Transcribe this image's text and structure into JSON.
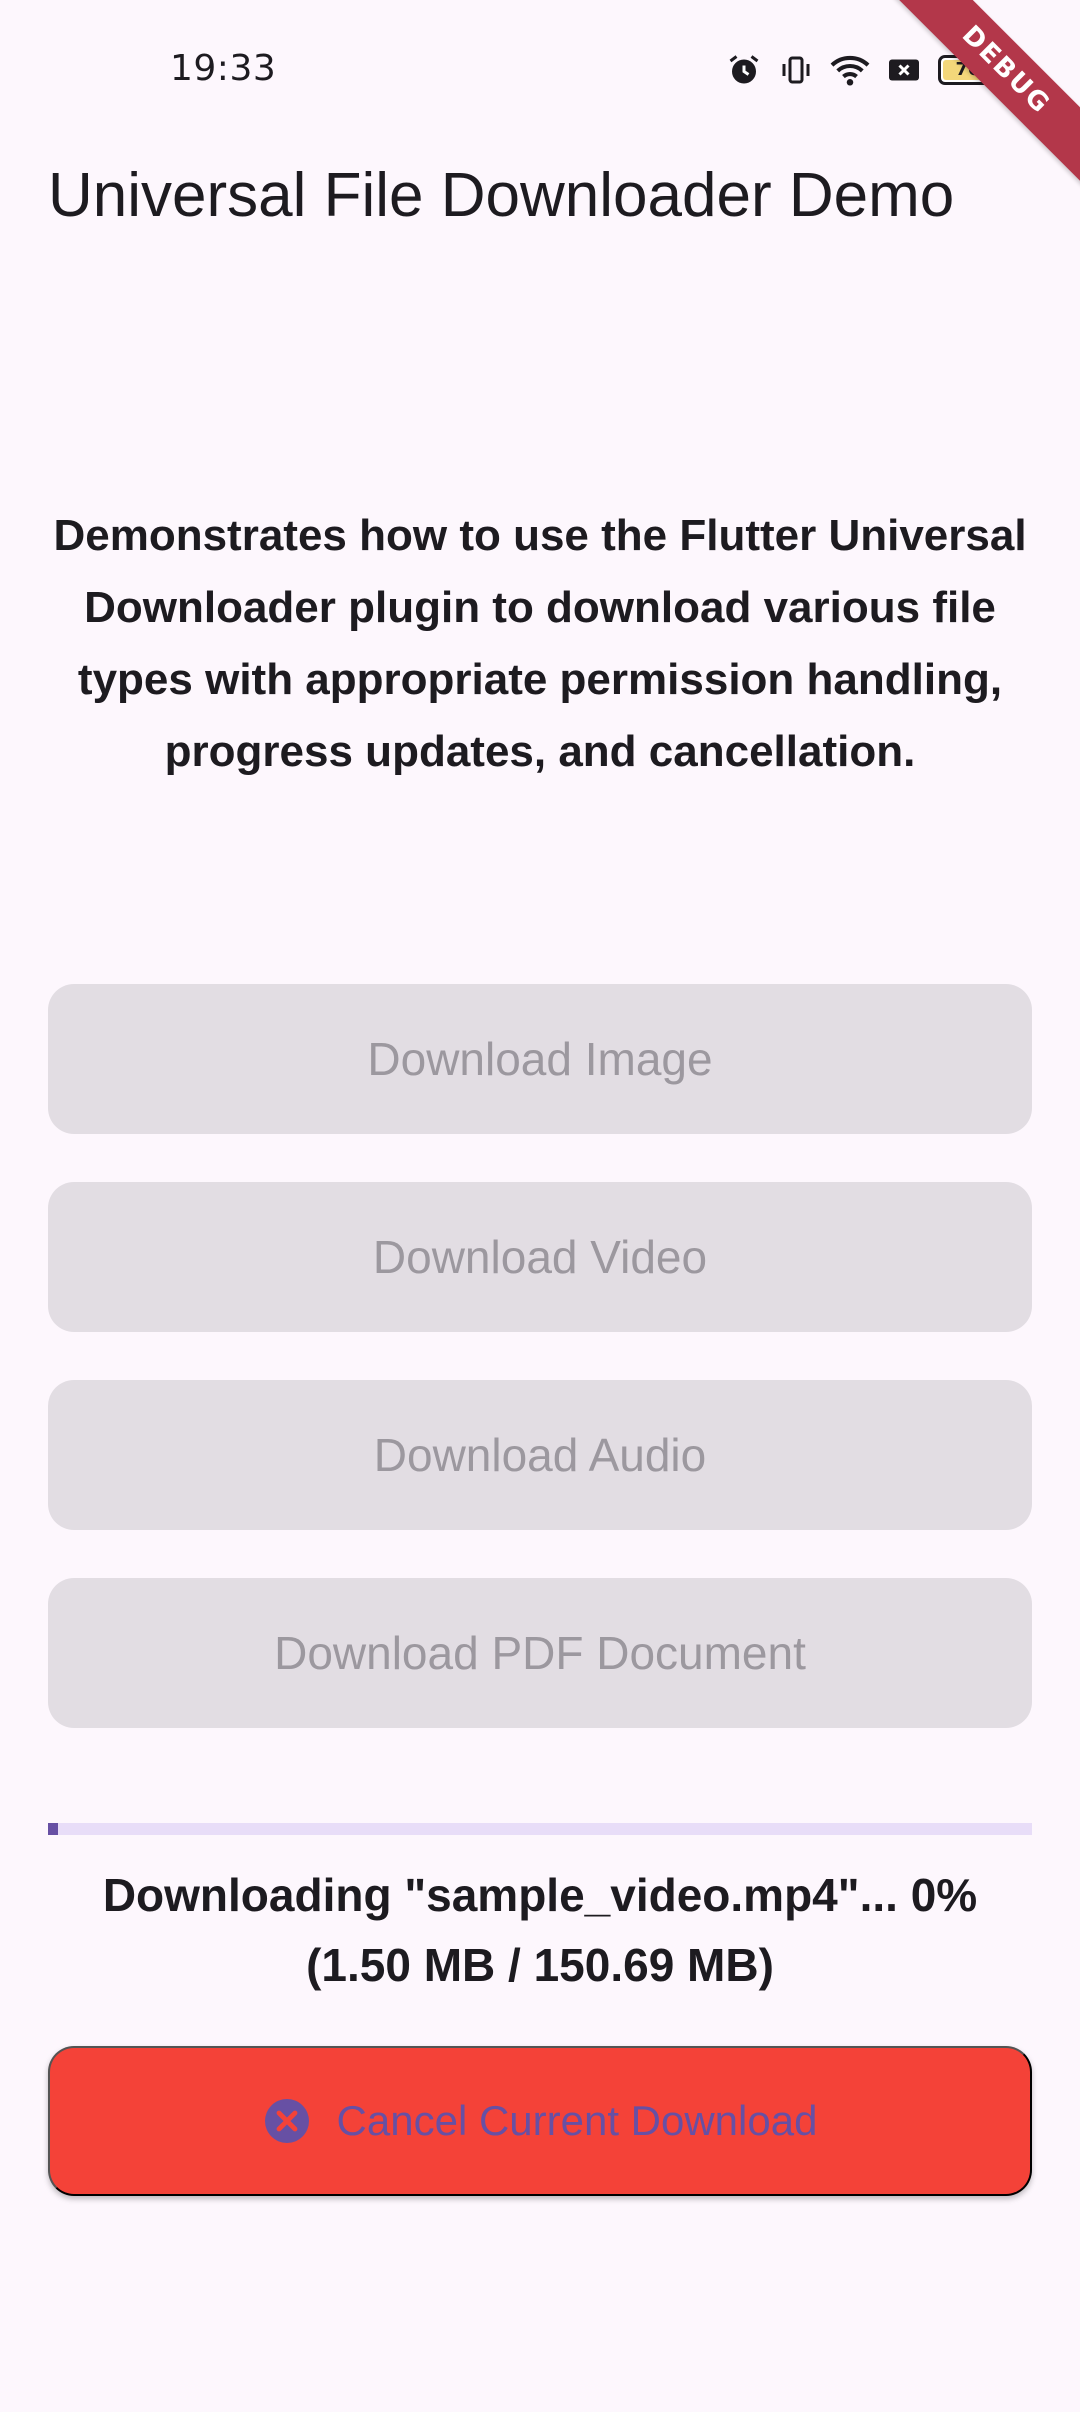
{
  "status_bar": {
    "time": "19:33",
    "battery_level": "70",
    "icons": [
      "alarm-icon",
      "vibrate-icon",
      "wifi-icon",
      "notification-x-icon",
      "battery-icon"
    ]
  },
  "debug_banner": "DEBUG",
  "app_bar": {
    "title": "Universal File Downloader Demo"
  },
  "description": "Demonstrates how to use the Flutter Universal Downloader plugin to download various file types with appropriate permission handling, progress updates, and cancellation.",
  "buttons": {
    "image": "Download Image",
    "video": "Download Video",
    "audio": "Download Audio",
    "pdf": "Download PDF Document"
  },
  "progress": {
    "fraction": 0.01,
    "line1": "Downloading \"sample_video.mp4\"... 0%",
    "line2": "(1.50 MB / 150.69 MB)"
  },
  "cancel": {
    "label": "Cancel Current Download",
    "icon": "cancel-circle-icon"
  },
  "colors": {
    "background": "#fdf7fd",
    "disabled_button": "#e2dde3",
    "disabled_text": "#9c989f",
    "progress_track": "#e8ddf8",
    "progress_fill": "#6750a4",
    "cancel_bg": "#f44238",
    "cancel_fg": "#6750a4",
    "debug_ribbon": "#b3374a"
  }
}
